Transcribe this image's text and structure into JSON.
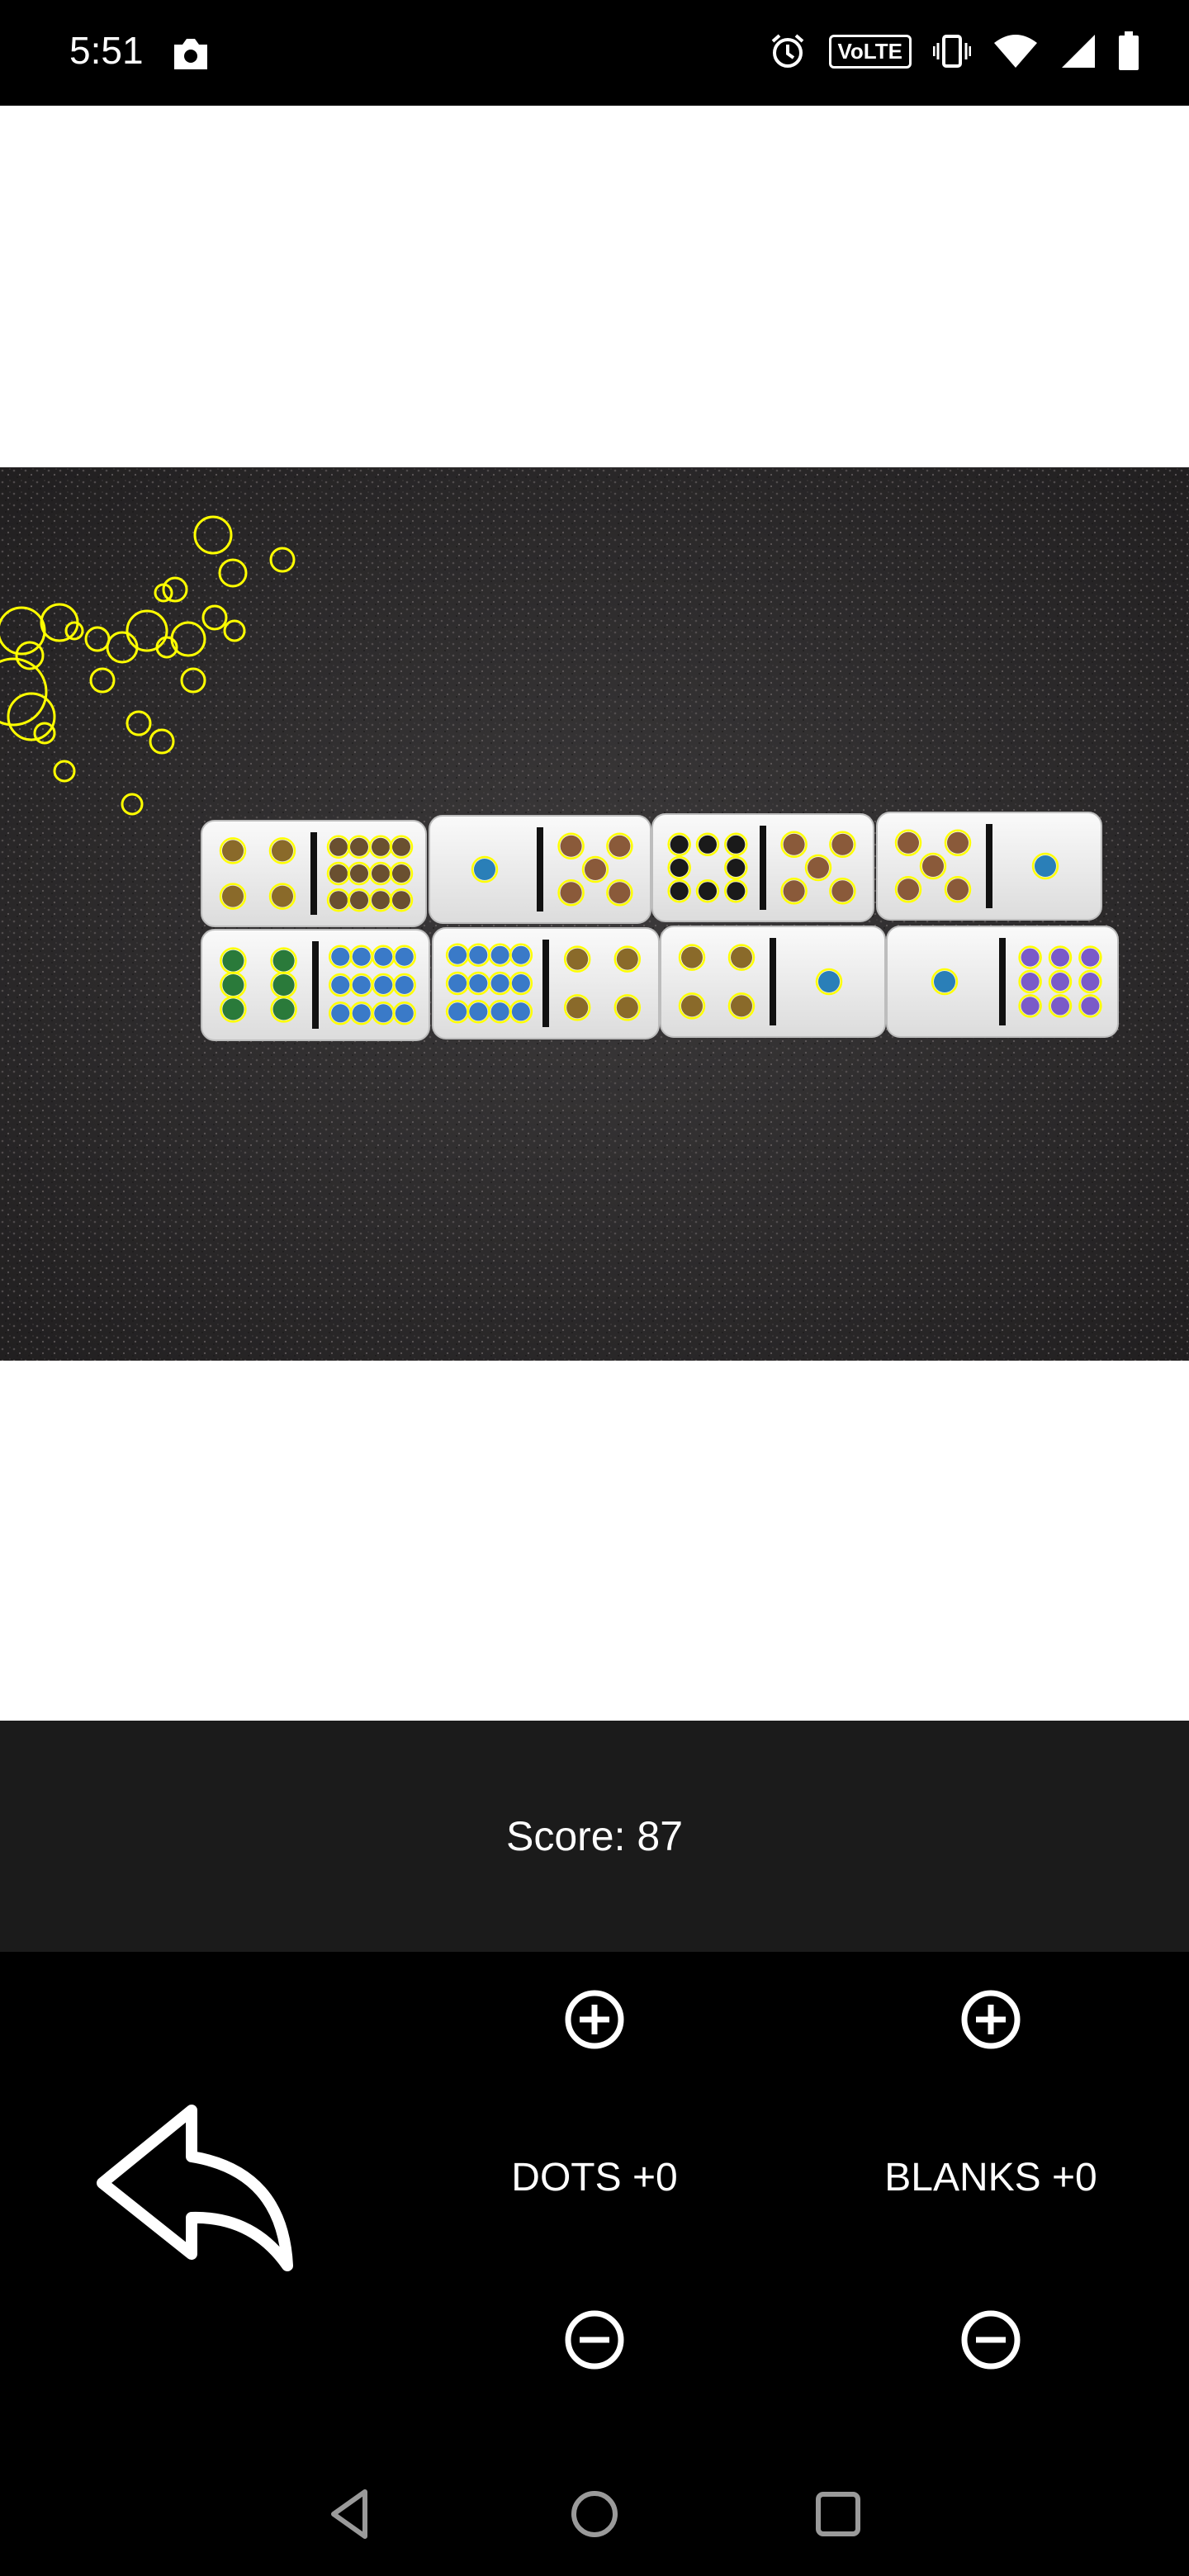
{
  "status_bar": {
    "time": "5:51",
    "volte_label": "VoLTE"
  },
  "score": {
    "text": "Score: 87"
  },
  "controls": {
    "dots_label": "DOTS +0",
    "blanks_label": "BLANKS +0"
  },
  "icons": {
    "back": "undo-arrow-icon",
    "plus": "plus-circle-icon",
    "minus": "minus-circle-icon",
    "nav_back": "triangle-back-icon",
    "nav_home": "circle-home-icon",
    "nav_recents": "square-recents-icon"
  },
  "colors": {
    "detection_circle": "#ffff00",
    "score_panel": "#1b1b1b",
    "background": "#000000"
  }
}
